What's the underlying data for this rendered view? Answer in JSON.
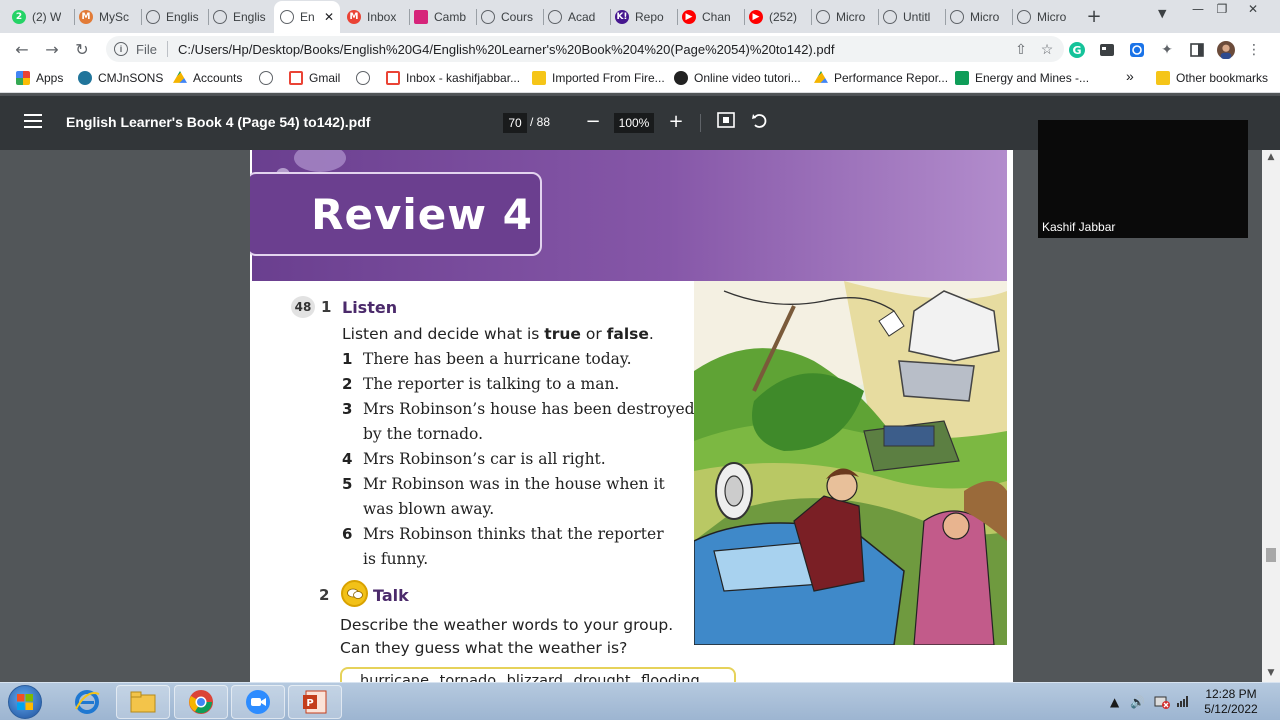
{
  "tabs": [
    {
      "title": "(2) W",
      "icon": "whatsapp-icon",
      "color": "#25d366"
    },
    {
      "title": "MySc",
      "icon": "myschool-icon",
      "color": "#e27b37"
    },
    {
      "title": "Englis",
      "icon": "globe-icon",
      "color": "#5f6368"
    },
    {
      "title": "Englis",
      "icon": "globe-icon",
      "color": "#5f6368"
    },
    {
      "title": "En",
      "icon": "globe-icon",
      "color": "#5f6368",
      "active": true
    },
    {
      "title": "Inbox",
      "icon": "gmail-icon",
      "color": "#ea4335"
    },
    {
      "title": "Camb",
      "icon": "cambridge-icon",
      "color": "#d6247a"
    },
    {
      "title": "Cours",
      "icon": "globe-icon",
      "color": "#5f6368"
    },
    {
      "title": "Acad",
      "icon": "globe-icon",
      "color": "#5f6368"
    },
    {
      "title": "Repo",
      "icon": "kahoot-icon",
      "color": "#46178f"
    },
    {
      "title": "Chan",
      "icon": "youtube-icon",
      "color": "#ff0000"
    },
    {
      "title": "(252)",
      "icon": "youtube-icon",
      "color": "#ff0000"
    },
    {
      "title": "Micro",
      "icon": "globe-icon",
      "color": "#5f6368"
    },
    {
      "title": "Untitl",
      "icon": "globe-icon",
      "color": "#5f6368"
    },
    {
      "title": "Micro",
      "icon": "globe-icon",
      "color": "#5f6368"
    },
    {
      "title": "Micro",
      "icon": "globe-icon",
      "color": "#5f6368"
    }
  ],
  "toolbar": {
    "scheme": "File",
    "url": "C:/Users/Hp/Desktop/Books/English%20G4/English%20Learner's%20Book%204%20(Page%2054)%20to142).pdf"
  },
  "bookmarks": [
    {
      "label": "Apps",
      "icon": "apps-grid-icon"
    },
    {
      "label": "CMJnSONS",
      "icon": "wordpress-icon"
    },
    {
      "label": "Accounts",
      "icon": "google-drive-icon"
    },
    {
      "label": "",
      "icon": "globe-icon"
    },
    {
      "label": "Gmail",
      "icon": "gmail-icon"
    },
    {
      "label": "",
      "icon": "globe-icon"
    },
    {
      "label": "Inbox - kashifjabbar...",
      "icon": "gmail-icon"
    },
    {
      "label": "Imported From Fire...",
      "icon": "folder-icon"
    },
    {
      "label": "Online video tutori...",
      "icon": "video-tutorial-icon"
    },
    {
      "label": "Performance Repor...",
      "icon": "google-drive-icon"
    },
    {
      "label": "Energy and Mines -...",
      "icon": "sheets-icon"
    }
  ],
  "bookmarks_more": "»",
  "other_bookmarks": "Other bookmarks",
  "pdf": {
    "title": "English Learner's Book 4 (Page 54) to142).pdf",
    "page": "70",
    "total": "/ 88",
    "zoom": "100%"
  },
  "page": {
    "heading": "Review 4",
    "track": "48",
    "section1": {
      "num": "1",
      "title": "Listen"
    },
    "instruction_parts": [
      "Listen and decide what is ",
      "true",
      " or ",
      "false",
      "."
    ],
    "items": [
      {
        "num": "1",
        "lines": [
          "There has been a hurricane today."
        ]
      },
      {
        "num": "2",
        "lines": [
          "The reporter is talking to a man."
        ]
      },
      {
        "num": "3",
        "lines": [
          "Mrs Robinson’s house has been destroyed",
          "by the tornado."
        ]
      },
      {
        "num": "4",
        "lines": [
          "Mrs Robinson’s car is all right."
        ]
      },
      {
        "num": "5",
        "lines": [
          "Mr Robinson was in the house when it",
          "was blown away."
        ]
      },
      {
        "num": "6",
        "lines": [
          "Mrs Robinson thinks that the reporter",
          "is funny."
        ]
      }
    ],
    "section2": {
      "num": "2",
      "title": "Talk"
    },
    "talk_lines": [
      "Describe the weather words to your group.",
      "Can they guess what the weather is?"
    ],
    "word_box": "hurricane   tornado   blizzard   drought   flooding"
  },
  "webcam": {
    "name": "Kashif Jabbar"
  },
  "clock": {
    "time": "12:28 PM",
    "date": "5/12/2022"
  },
  "colors": {
    "banner": "#6a3f8f",
    "title_purple": "#4b2a6b",
    "pdf_toolbar": "#323639"
  }
}
